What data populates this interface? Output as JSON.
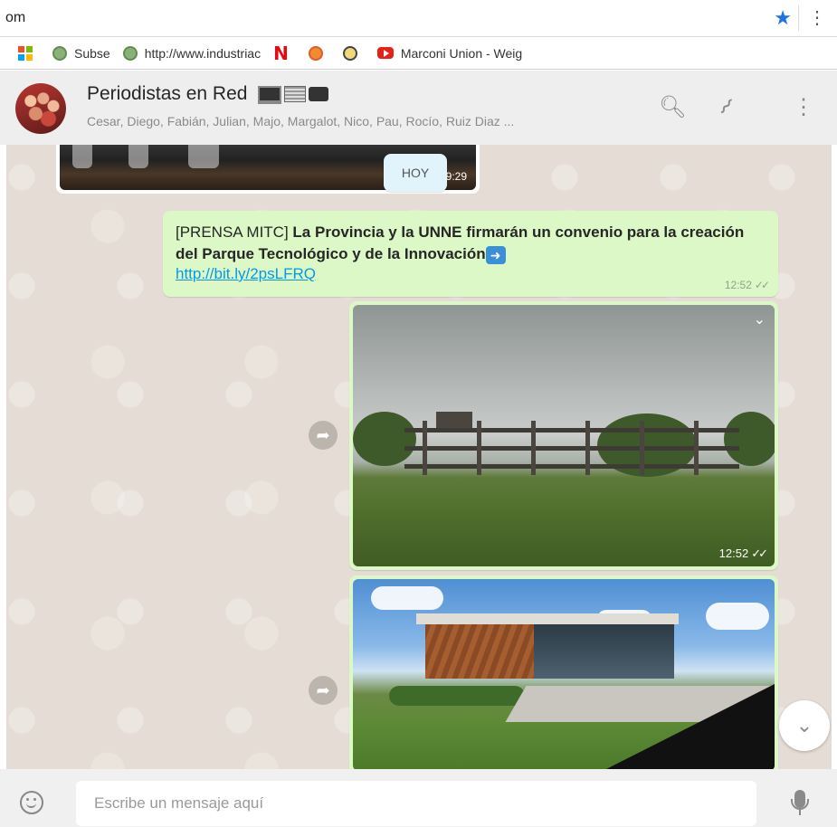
{
  "browser": {
    "url_fragment": "om",
    "star_icon": "star-icon",
    "menu_icon": "kebab-menu-icon"
  },
  "bookmarks": [
    {
      "icon": "windows-apps-icon",
      "label": ""
    },
    {
      "icon": "site-icon",
      "label": "Subse"
    },
    {
      "icon": "site-icon",
      "label": "http://www.industriac"
    },
    {
      "icon": "netflix-icon",
      "label": ""
    },
    {
      "icon": "gear-site-icon",
      "label": ""
    },
    {
      "icon": "disc-site-icon",
      "label": ""
    },
    {
      "icon": "youtube-icon",
      "label": "Marconi Union - Weig"
    }
  ],
  "chat": {
    "title": "Periodistas en Red",
    "participants": "Cesar, Diego, Fabián, Julian, Majo, Margalot, Nico, Pau, Rocío, Ruiz Diaz ..."
  },
  "messages": {
    "top_image_time": "09:29",
    "day_chip": "HOY",
    "text_prefix": "[PRENSA MITC] ",
    "text_bold": "La Provincia y la UNNE firmarán un convenio para la creación del Parque Tecnológico y de la Innovación",
    "link": "http://bit.ly/2psLFRQ",
    "text_time": "12:52",
    "image1_time": "12:52"
  },
  "compose": {
    "placeholder": "Escribe un mensaje aquí"
  },
  "colors": {
    "outgoing_bubble": "#dcf8c6",
    "chat_background": "#e5ddd5",
    "link": "#039be5",
    "header": "#eeeeee"
  }
}
